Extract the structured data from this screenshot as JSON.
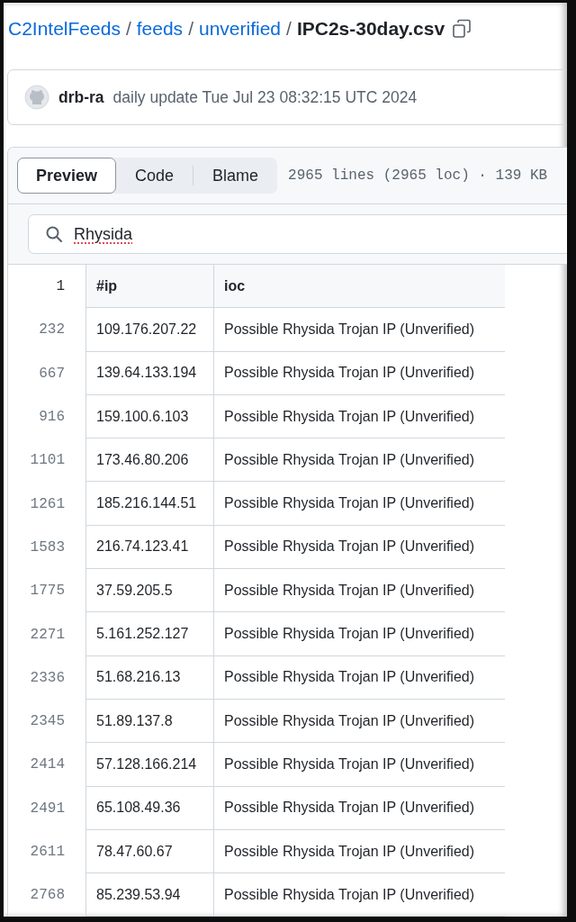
{
  "breadcrumb": {
    "links": [
      "C2IntelFeeds",
      "feeds",
      "unverified"
    ],
    "separator": "/",
    "file": "IPC2s-30day.csv"
  },
  "commit": {
    "author": "drb-ra",
    "message": "daily update Tue Jul 23 08:32:15 UTC 2024"
  },
  "tabs": [
    {
      "label": "Preview",
      "selected": true
    },
    {
      "label": "Code",
      "selected": false
    },
    {
      "label": "Blame",
      "selected": false
    }
  ],
  "file_stats": "2965 lines (2965 loc) · 139 KB",
  "search": {
    "value": "Rhysida"
  },
  "table": {
    "header": {
      "line": "1",
      "columns": [
        "#ip",
        "ioc"
      ]
    },
    "rows": [
      {
        "line": "232",
        "ip": "109.176.207.22",
        "ioc": "Possible Rhysida Trojan IP (Unverified)"
      },
      {
        "line": "667",
        "ip": "139.64.133.194",
        "ioc": "Possible Rhysida Trojan IP (Unverified)"
      },
      {
        "line": "916",
        "ip": "159.100.6.103",
        "ioc": "Possible Rhysida Trojan IP (Unverified)"
      },
      {
        "line": "1101",
        "ip": "173.46.80.206",
        "ioc": "Possible Rhysida Trojan IP (Unverified)"
      },
      {
        "line": "1261",
        "ip": "185.216.144.51",
        "ioc": "Possible Rhysida Trojan IP (Unverified)"
      },
      {
        "line": "1583",
        "ip": "216.74.123.41",
        "ioc": "Possible Rhysida Trojan IP (Unverified)"
      },
      {
        "line": "1775",
        "ip": "37.59.205.5",
        "ioc": "Possible Rhysida Trojan IP (Unverified)"
      },
      {
        "line": "2271",
        "ip": "5.161.252.127",
        "ioc": "Possible Rhysida Trojan IP (Unverified)"
      },
      {
        "line": "2336",
        "ip": "51.68.216.13",
        "ioc": "Possible Rhysida Trojan IP (Unverified)"
      },
      {
        "line": "2345",
        "ip": "51.89.137.8",
        "ioc": "Possible Rhysida Trojan IP (Unverified)"
      },
      {
        "line": "2414",
        "ip": "57.128.166.214",
        "ioc": "Possible Rhysida Trojan IP (Unverified)"
      },
      {
        "line": "2491",
        "ip": "65.108.49.36",
        "ioc": "Possible Rhysida Trojan IP (Unverified)"
      },
      {
        "line": "2611",
        "ip": "78.47.60.67",
        "ioc": "Possible Rhysida Trojan IP (Unverified)"
      },
      {
        "line": "2768",
        "ip": "85.239.53.94",
        "ioc": "Possible Rhysida Trojan IP (Unverified)"
      }
    ]
  }
}
